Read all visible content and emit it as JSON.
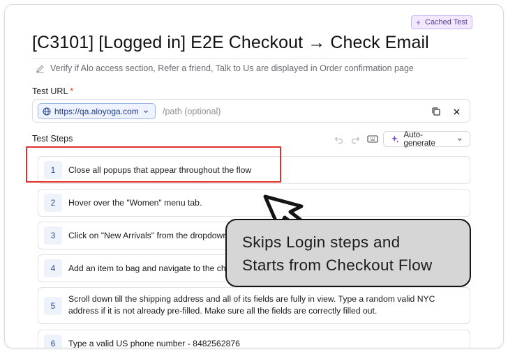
{
  "badge": {
    "label": "Cached Test",
    "icon": "sparkle-bolt-icon"
  },
  "title": "[C3101] [Logged in] E2E Checkout → Check Email",
  "description": "Verify if Alo access section, Refer a friend, Talk to Us are displayed in Order confirmation page",
  "test_url": {
    "label": "Test URL",
    "required_marker": "*",
    "domain": "https://qa.aloyoga.com",
    "path_placeholder": "/path (optional)",
    "path_value": ""
  },
  "test_steps": {
    "label": "Test Steps",
    "autogen_label": "Auto-generate",
    "steps": [
      {
        "num": "1",
        "text": "Close all popups that appear throughout the flow"
      },
      {
        "num": "2",
        "text": "Hover over the \"Women\" menu tab."
      },
      {
        "num": "3",
        "text": "Click on \"New Arrivals\" from the dropdown"
      },
      {
        "num": "4",
        "text": "Add an item to bag and navigate to the chec"
      },
      {
        "num": "5",
        "text": "Scroll down till the shipping address and all of its fields are fully in view. Type a random valid NYC address if it is not already pre-filled. Make sure all the fields are correctly filled out."
      },
      {
        "num": "6",
        "text": "Type a valid US phone number - 8482562876"
      }
    ]
  },
  "annotation": {
    "line1": "Skips Login steps and",
    "line2": "Starts from Checkout Flow",
    "highlight_color": "#e0302b"
  },
  "colors": {
    "accent_purple": "#7b4fd6",
    "link_blue": "#1f3f8a",
    "step_badge_bg": "#eef2fb"
  }
}
